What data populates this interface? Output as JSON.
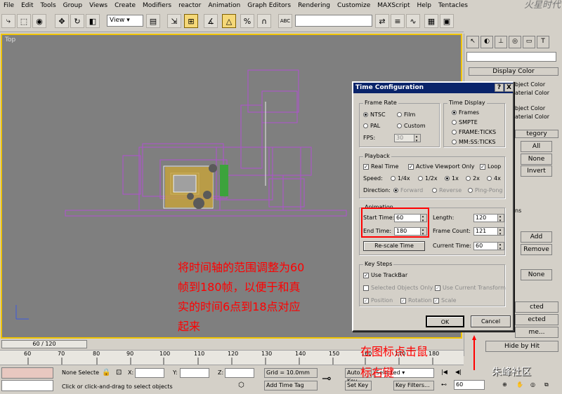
{
  "menubar": {
    "items": [
      "File",
      "Edit",
      "Tools",
      "Group",
      "Views",
      "Create",
      "Modifiers",
      "reactor",
      "Animation",
      "Graph Editors",
      "Rendering",
      "Customize",
      "MAXScript",
      "Help",
      "Tentacles"
    ]
  },
  "logo": {
    "text": "火星时代"
  },
  "toolbar": {
    "view_select": "View",
    "abc_label": "ABC"
  },
  "viewport": {
    "label": "Top",
    "annotation_lines": [
      "将时间轴的范围调整为60",
      "帧到180帧，以便于和真",
      "实的时间6点到18点对应",
      "起来"
    ]
  },
  "command_panel": {
    "rollout_title": "Display Color",
    "texts": [
      "bject Color",
      "aterial Color",
      "bject Color",
      "aterial Color",
      "tegory",
      "ns"
    ],
    "buttons": [
      "All",
      "None",
      "Invert",
      "Add",
      "Remove",
      "None",
      "cted",
      "ected",
      "me...",
      "Hide by Hit"
    ]
  },
  "dialog": {
    "title": "Time Configuration",
    "help_btn": "?",
    "close_btn": "X",
    "frame_rate": {
      "label": "Frame Rate",
      "options": [
        "NTSC",
        "Film",
        "PAL",
        "Custom"
      ],
      "selected": "NTSC",
      "fps_label": "FPS:",
      "fps_value": "30"
    },
    "time_display": {
      "label": "Time Display",
      "options": [
        "Frames",
        "SMPTE",
        "FRAME:TICKS",
        "MM:SS:TICKS"
      ],
      "selected": "Frames"
    },
    "playback": {
      "label": "Playback",
      "real_time": "Real Time",
      "active_viewport": "Active Viewport Only",
      "loop": "Loop",
      "speed_label": "Speed:",
      "speeds": [
        "1/4x",
        "1/2x",
        "1x",
        "2x",
        "4x"
      ],
      "speed_selected": "1x",
      "direction_label": "Direction:",
      "directions": [
        "Forward",
        "Reverse",
        "Ping-Pong"
      ]
    },
    "animation": {
      "label": "Animation",
      "start_time_label": "Start Time:",
      "start_time": "60",
      "end_time_label": "End Time:",
      "end_time": "180",
      "length_label": "Length:",
      "length": "120",
      "frame_count_label": "Frame Count:",
      "frame_count": "121",
      "rescale_btn": "Re-scale Time",
      "current_time_label": "Current Time:",
      "current_time": "60"
    },
    "key_steps": {
      "label": "Key Steps",
      "use_trackbar": "Use TrackBar",
      "selected_only": "Selected Objects Only",
      "use_current": "Use Current Transform",
      "position": "Position",
      "rotation": "Rotation",
      "scale": "Scale"
    },
    "ok_btn": "OK",
    "cancel_btn": "Cancel"
  },
  "timeline": {
    "slider_text": "60 / 120",
    "ticks": [
      "60",
      "70",
      "80",
      "90",
      "100",
      "110",
      "120",
      "130",
      "140",
      "150",
      "160",
      "170",
      "180"
    ]
  },
  "status": {
    "none_selected": "None Selecte",
    "x_label": "X:",
    "y_label": "Y:",
    "z_label": "Z:",
    "grid": "Grid = 10.0mm",
    "prompt": "Click or click-and-drag to select objects",
    "add_time_tag": "Add Time Tag",
    "auto_key": "Auto Key",
    "set_key": "Set Key",
    "selected_dropdown": "Selected",
    "filters": "Key Filters...",
    "frame_value": "60"
  },
  "annotation2": {
    "lines": [
      "在图标点击鼠",
      "标右键"
    ]
  },
  "watermark": {
    "text": "朱峰社区"
  },
  "colors": {
    "annotation": "#ff0000",
    "viewport_bg": "#7f7f7f",
    "active_border": "#f0c400",
    "title_bar": "#0a246a"
  }
}
